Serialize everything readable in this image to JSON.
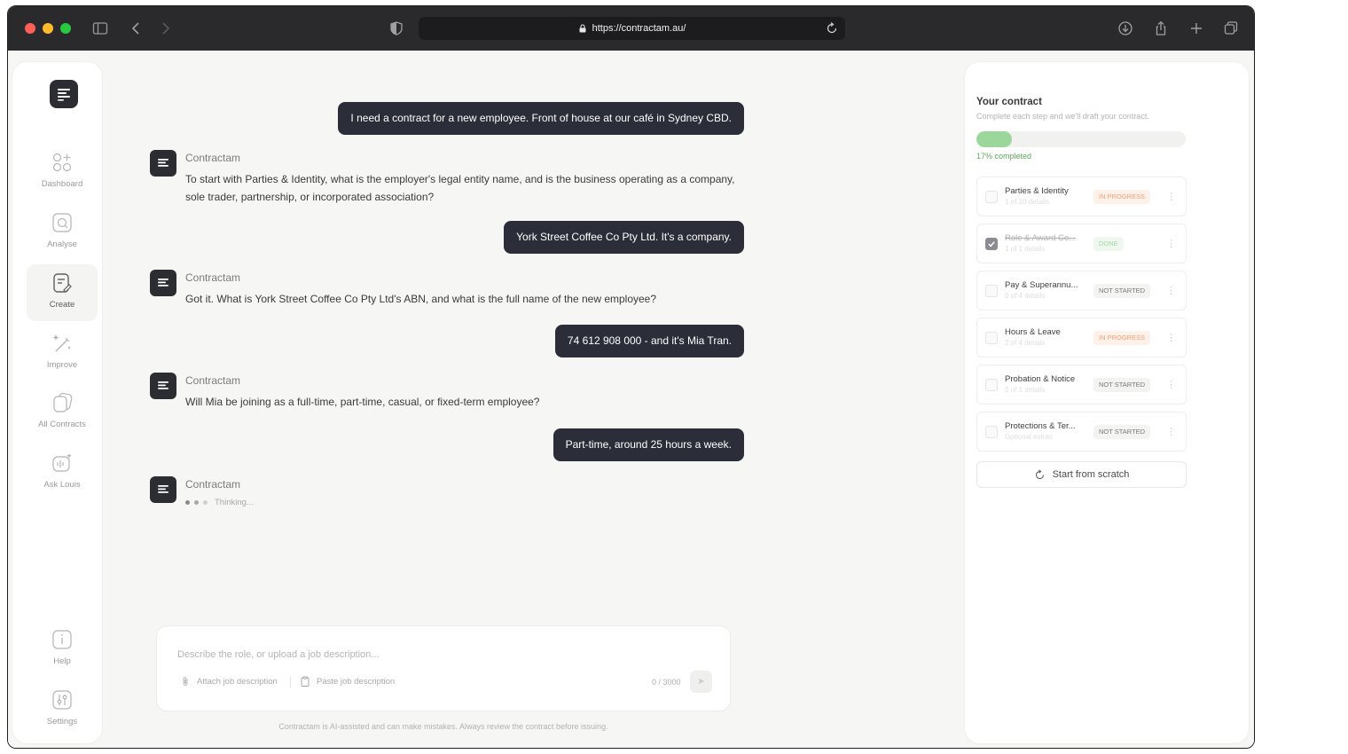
{
  "browser": {
    "url": "https://contractam.au/"
  },
  "sidebar": {
    "items": [
      {
        "label": "Dashboard",
        "icon": "dashboard-icon"
      },
      {
        "label": "Analyse",
        "icon": "analyse-icon"
      },
      {
        "label": "Create",
        "icon": "create-icon",
        "active": true
      },
      {
        "label": "Improve",
        "icon": "improve-icon"
      },
      {
        "label": "All Contracts",
        "icon": "contracts-icon"
      },
      {
        "label": "Ask Louis",
        "icon": "ask-icon"
      }
    ],
    "bottom_items": [
      {
        "label": "Help",
        "icon": "help-icon"
      },
      {
        "label": "Settings",
        "icon": "settings-icon"
      }
    ]
  },
  "chat": {
    "bot_name": "Contractam",
    "messages": [
      {
        "role": "user",
        "text": "I need a contract for a new employee. Front of house at our café in Sydney CBD."
      },
      {
        "role": "bot",
        "text": "To start with Parties & Identity, what is the employer's legal entity name, and is the business operating as a company, sole trader, partnership, or incorporated association?"
      },
      {
        "role": "user",
        "text": "York Street Coffee Co Pty Ltd. It's a company."
      },
      {
        "role": "bot",
        "text": "Got it. What is York Street Coffee Co Pty Ltd's ABN, and what is the full name of the new employee?"
      },
      {
        "role": "user",
        "text": "74 612 908 000 - and it's Mia Tran."
      },
      {
        "role": "bot",
        "text": "Will Mia be joining as a full-time, part-time, casual, or fixed-term employee?"
      },
      {
        "role": "user",
        "text": "Part-time, around 25 hours a week."
      }
    ],
    "thinking_label": "Thinking..."
  },
  "composer": {
    "placeholder": "Describe the role, or upload a job description...",
    "attach_label": "Attach job description",
    "paste_label": "Paste job description",
    "counter": "0 / 3000",
    "disclaimer": "Contractam is AI-assisted and can make mistakes. Always review the contract before issuing."
  },
  "contract_panel": {
    "title": "Your contract",
    "subtitle": "Complete each step and we'll draft your contract.",
    "progress_percent": 17,
    "progress_label": "17% completed",
    "steps": [
      {
        "title": "Parties & Identity",
        "sub": "1 of 10 details",
        "status": "IN PROGRESS",
        "status_kind": "inprog",
        "checked": false
      },
      {
        "title": "Role & Award Co...",
        "sub": "1 of 1 details",
        "status": "DONE",
        "status_kind": "done",
        "checked": true
      },
      {
        "title": "Pay & Superannu...",
        "sub": "0 of 4 details",
        "status": "NOT STARTED",
        "status_kind": "notstarted",
        "checked": false
      },
      {
        "title": "Hours & Leave",
        "sub": "2 of 4 details",
        "status": "IN PROGRESS",
        "status_kind": "inprog",
        "checked": false
      },
      {
        "title": "Probation & Notice",
        "sub": "0 of 1 details",
        "status": "NOT STARTED",
        "status_kind": "notstarted",
        "checked": false
      },
      {
        "title": "Protections & Ter...",
        "sub": "Optional extras",
        "status": "NOT STARTED",
        "status_kind": "notstarted",
        "checked": false
      }
    ],
    "start_scratch_label": "Start from scratch"
  },
  "colors": {
    "bubble": "#2b2d38",
    "progress_fill": "#9bd79a",
    "in_progress": "#f0a173",
    "done": "#a4d7a3"
  }
}
